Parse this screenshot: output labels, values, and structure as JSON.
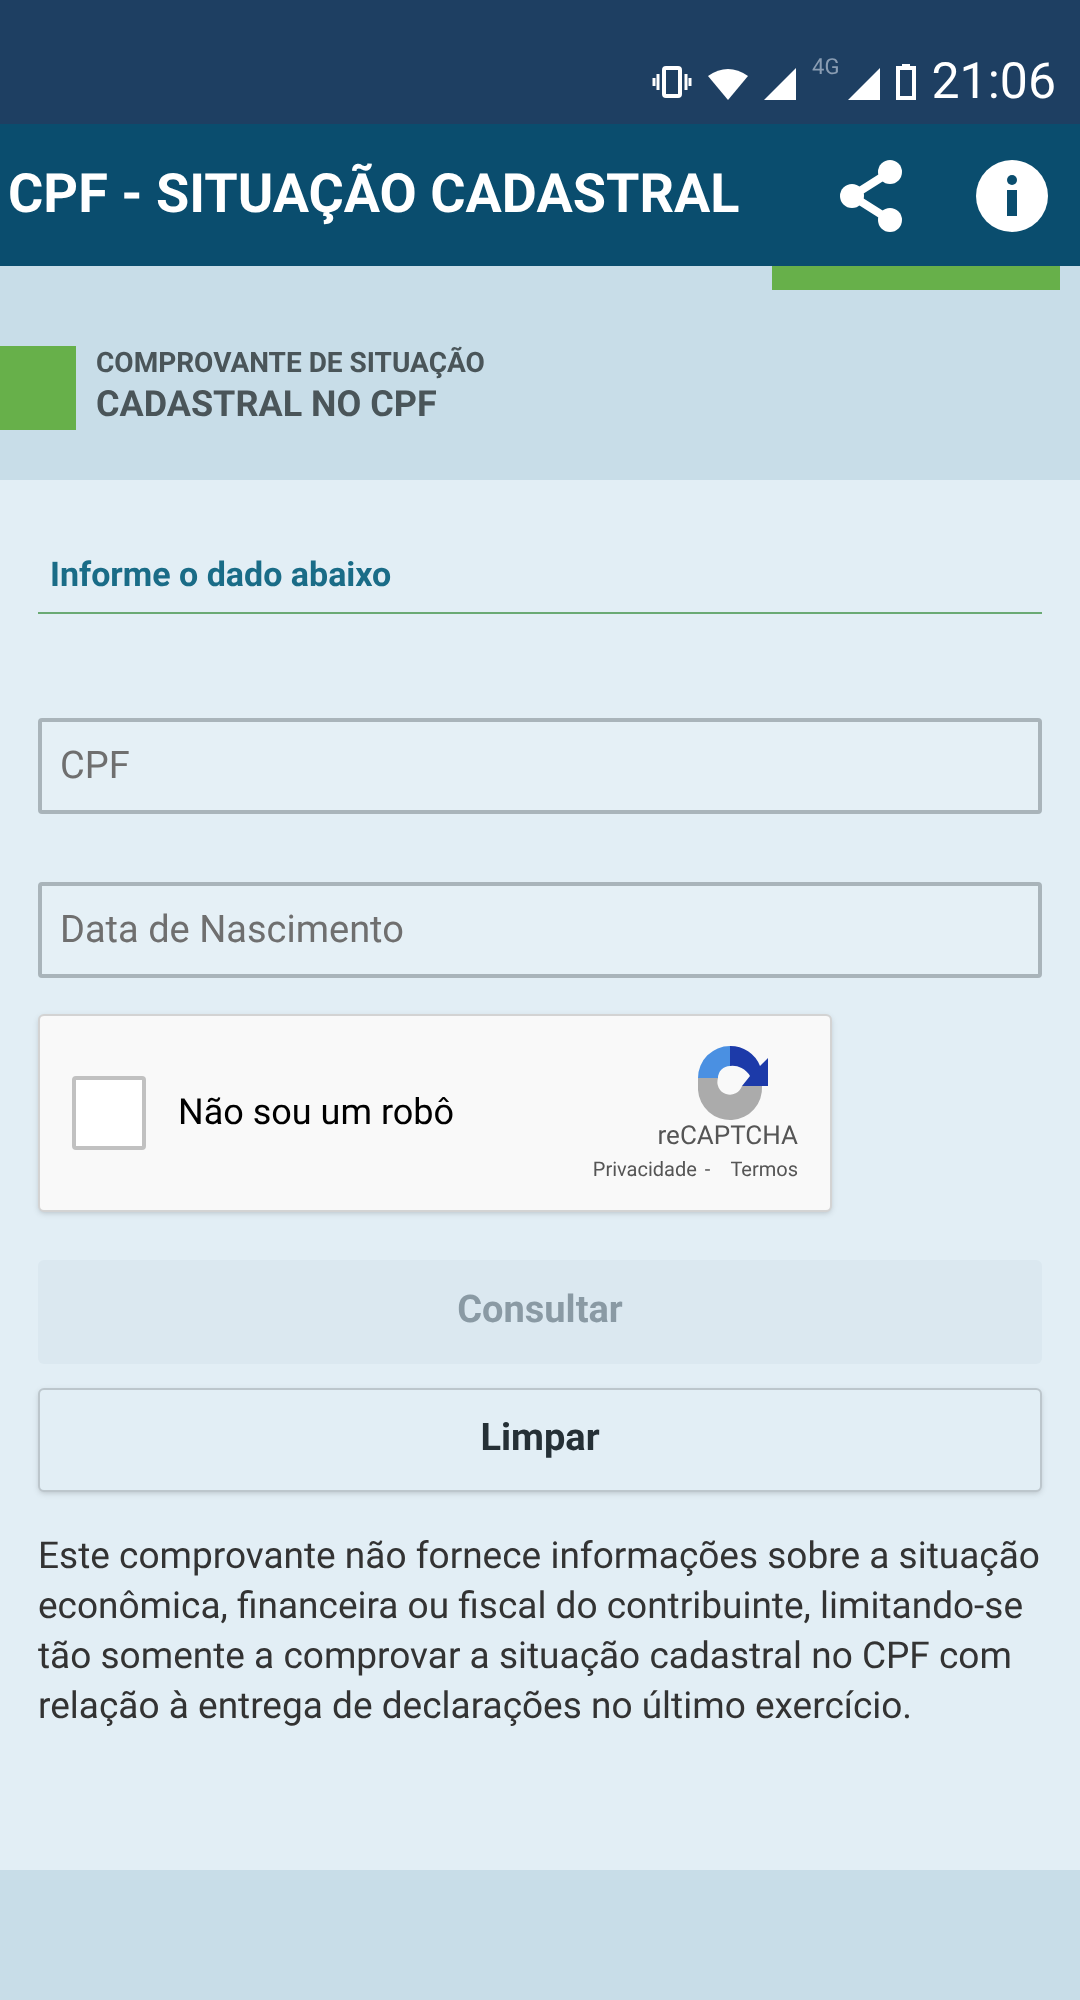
{
  "status_bar": {
    "network": "4G",
    "time": "21:06"
  },
  "app_bar": {
    "title": "CPF - SITUAÇÃO CADASTRAL"
  },
  "section": {
    "line1": "COMPROVANTE DE SITUAÇÃO",
    "line2": "CADASTRAL NO CPF"
  },
  "form": {
    "heading": "Informe o dado abaixo",
    "fields": [
      {
        "placeholder": "CPF"
      },
      {
        "placeholder": "Data de Nascimento"
      }
    ],
    "captcha": {
      "label": "Não sou um robô",
      "checked": false,
      "brand": "reCAPTCHA",
      "privacy": "Privacidade",
      "separator": "-",
      "terms": "Termos"
    },
    "buttons": [
      {
        "label": "Consultar",
        "disabled": true
      },
      {
        "label": "Limpar",
        "disabled": false
      }
    ],
    "note": "Este comprovante não fornece informações sobre a situação econômica, financeira ou fiscal do contribuinte, limitando-se tão somente a comprovar a situação cadastral no CPF com relação à entrega de declarações no último exercício."
  }
}
